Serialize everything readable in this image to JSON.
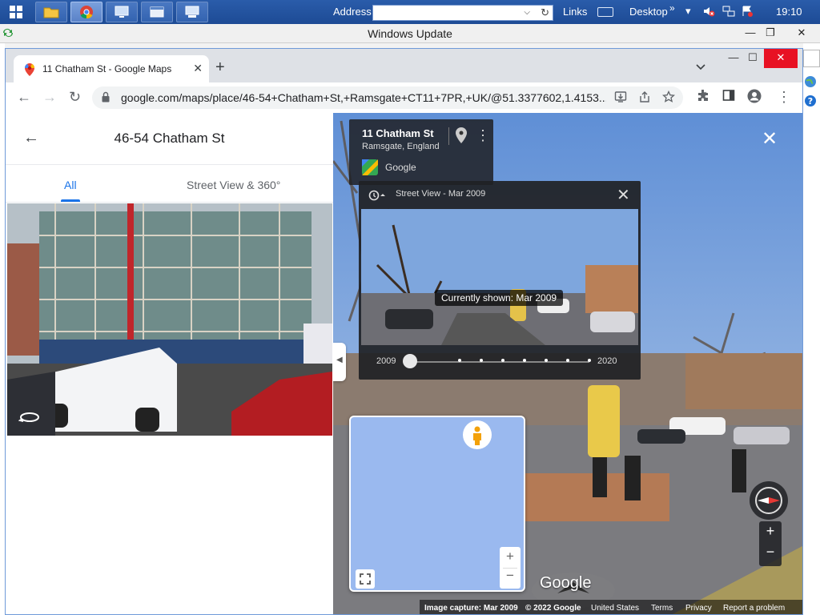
{
  "taskbar": {
    "address_label": "Address",
    "links_label": "Links",
    "desktop_label": "Desktop",
    "overflow": "»",
    "clock": "19:10"
  },
  "window": {
    "title": "Windows Update",
    "min": "—",
    "restore": "❐",
    "close": "✕"
  },
  "browser": {
    "tab_title": "11 Chatham St - Google Maps",
    "tab_close": "✕",
    "new_tab": "+",
    "tab_search": "⌄",
    "url": "google.com/maps/place/46-54+Chatham+St,+Ramsgate+CT11+7PR,+UK/@51.3377602,1.4153...",
    "back": "←",
    "forward": "→",
    "reload": "↻",
    "win_min": "—",
    "win_max": "☐",
    "win_close": "✕"
  },
  "panel": {
    "back": "←",
    "title": "46-54 Chatham St",
    "tab_all": "All",
    "tab_street_view": "Street View & 360°"
  },
  "street_view": {
    "street": "11 Chatham St",
    "city": "Ramsgate, England",
    "source": "Google",
    "more": "⋮",
    "close": "✕",
    "collapse": "◀",
    "time_header": "Street View - Mar 2009",
    "time_close": "✕",
    "currently_shown": "Currently shown: Mar 2009",
    "year_start": "2009",
    "year_end": "2020",
    "timeline_position": 0,
    "timeline_dots": 7,
    "zoom_in": "+",
    "zoom_out": "−",
    "logo": "Google",
    "attribution": {
      "capture": "Image capture: Mar 2009",
      "copyright": "© 2022 Google",
      "country": "United States",
      "terms": "Terms",
      "privacy": "Privacy",
      "report": "Report a problem"
    }
  },
  "colors": {
    "accent": "#1a73e8",
    "taskbar": "#1d4b95",
    "chrome_close": "#e81123"
  }
}
